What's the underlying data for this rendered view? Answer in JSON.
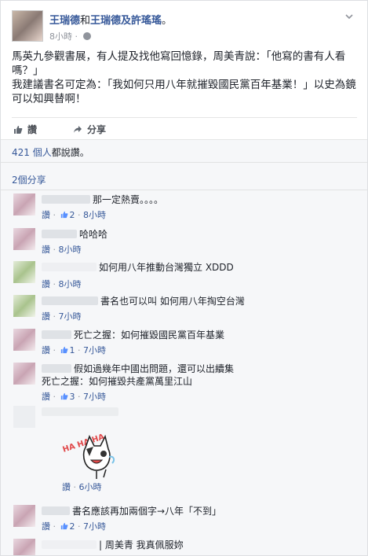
{
  "post": {
    "author": "王瑞德",
    "with_text": "和",
    "tagged": "王瑞德及許瑤瑤",
    "dot": "。",
    "time": "8小時",
    "privacy_sep": "·",
    "body_line1": "馬英九參觀書展，有人提及找他寫回憶錄，周美青說：「他寫的書有人看嗎？」",
    "body_line2": "我建議書名可定為：「我如何只用八年就摧毀國民黨百年基業！」以史為鏡可以知興替啊！"
  },
  "actions": {
    "like": "讚",
    "share": "分享"
  },
  "feedback": {
    "likes_count": "421 個人",
    "likes_suffix": "都說讚。",
    "shares": "2個分享"
  },
  "comments": [
    {
      "text": "那一定熱賣。。。。",
      "like": "讚",
      "sep": "·",
      "count": "2",
      "time": "8小時"
    },
    {
      "text": "哈哈哈",
      "like": "讚",
      "sep": "·",
      "count": "",
      "time": "8小時"
    },
    {
      "text": "如何用八年推動台灣獨立 XDDD",
      "like": "讚",
      "sep": "·",
      "count": "",
      "time": "8小時"
    },
    {
      "text": "書名也可以叫 如何用八年掏空台灣",
      "like": "讚",
      "sep": "·",
      "count": "",
      "time": "7小時"
    },
    {
      "text": "死亡之握：如何摧毀國民黨百年基業",
      "like": "讚",
      "sep": "·",
      "count": "1",
      "time": "7小時"
    },
    {
      "text": "假如過幾年中國出問題，還可以出續集",
      "text2": "死亡之握：如何摧毀共產黨萬里江山",
      "like": "讚",
      "sep": "·",
      "count": "3",
      "time": "7小時"
    },
    {
      "like": "讚",
      "sep": "·",
      "time": "6小時"
    },
    {
      "text": "書名應該再加兩個字→八年「不到」",
      "like": "讚",
      "sep": "·",
      "count": "2",
      "time": "7小時"
    },
    {
      "text": "| 周美青 我真佩服妳"
    }
  ],
  "sticker": {
    "text": "HA HA HA"
  },
  "colors": {
    "link": "#365899",
    "muted": "#90949c",
    "text": "#1d2129",
    "feedback_bg": "#f6f7f9"
  }
}
